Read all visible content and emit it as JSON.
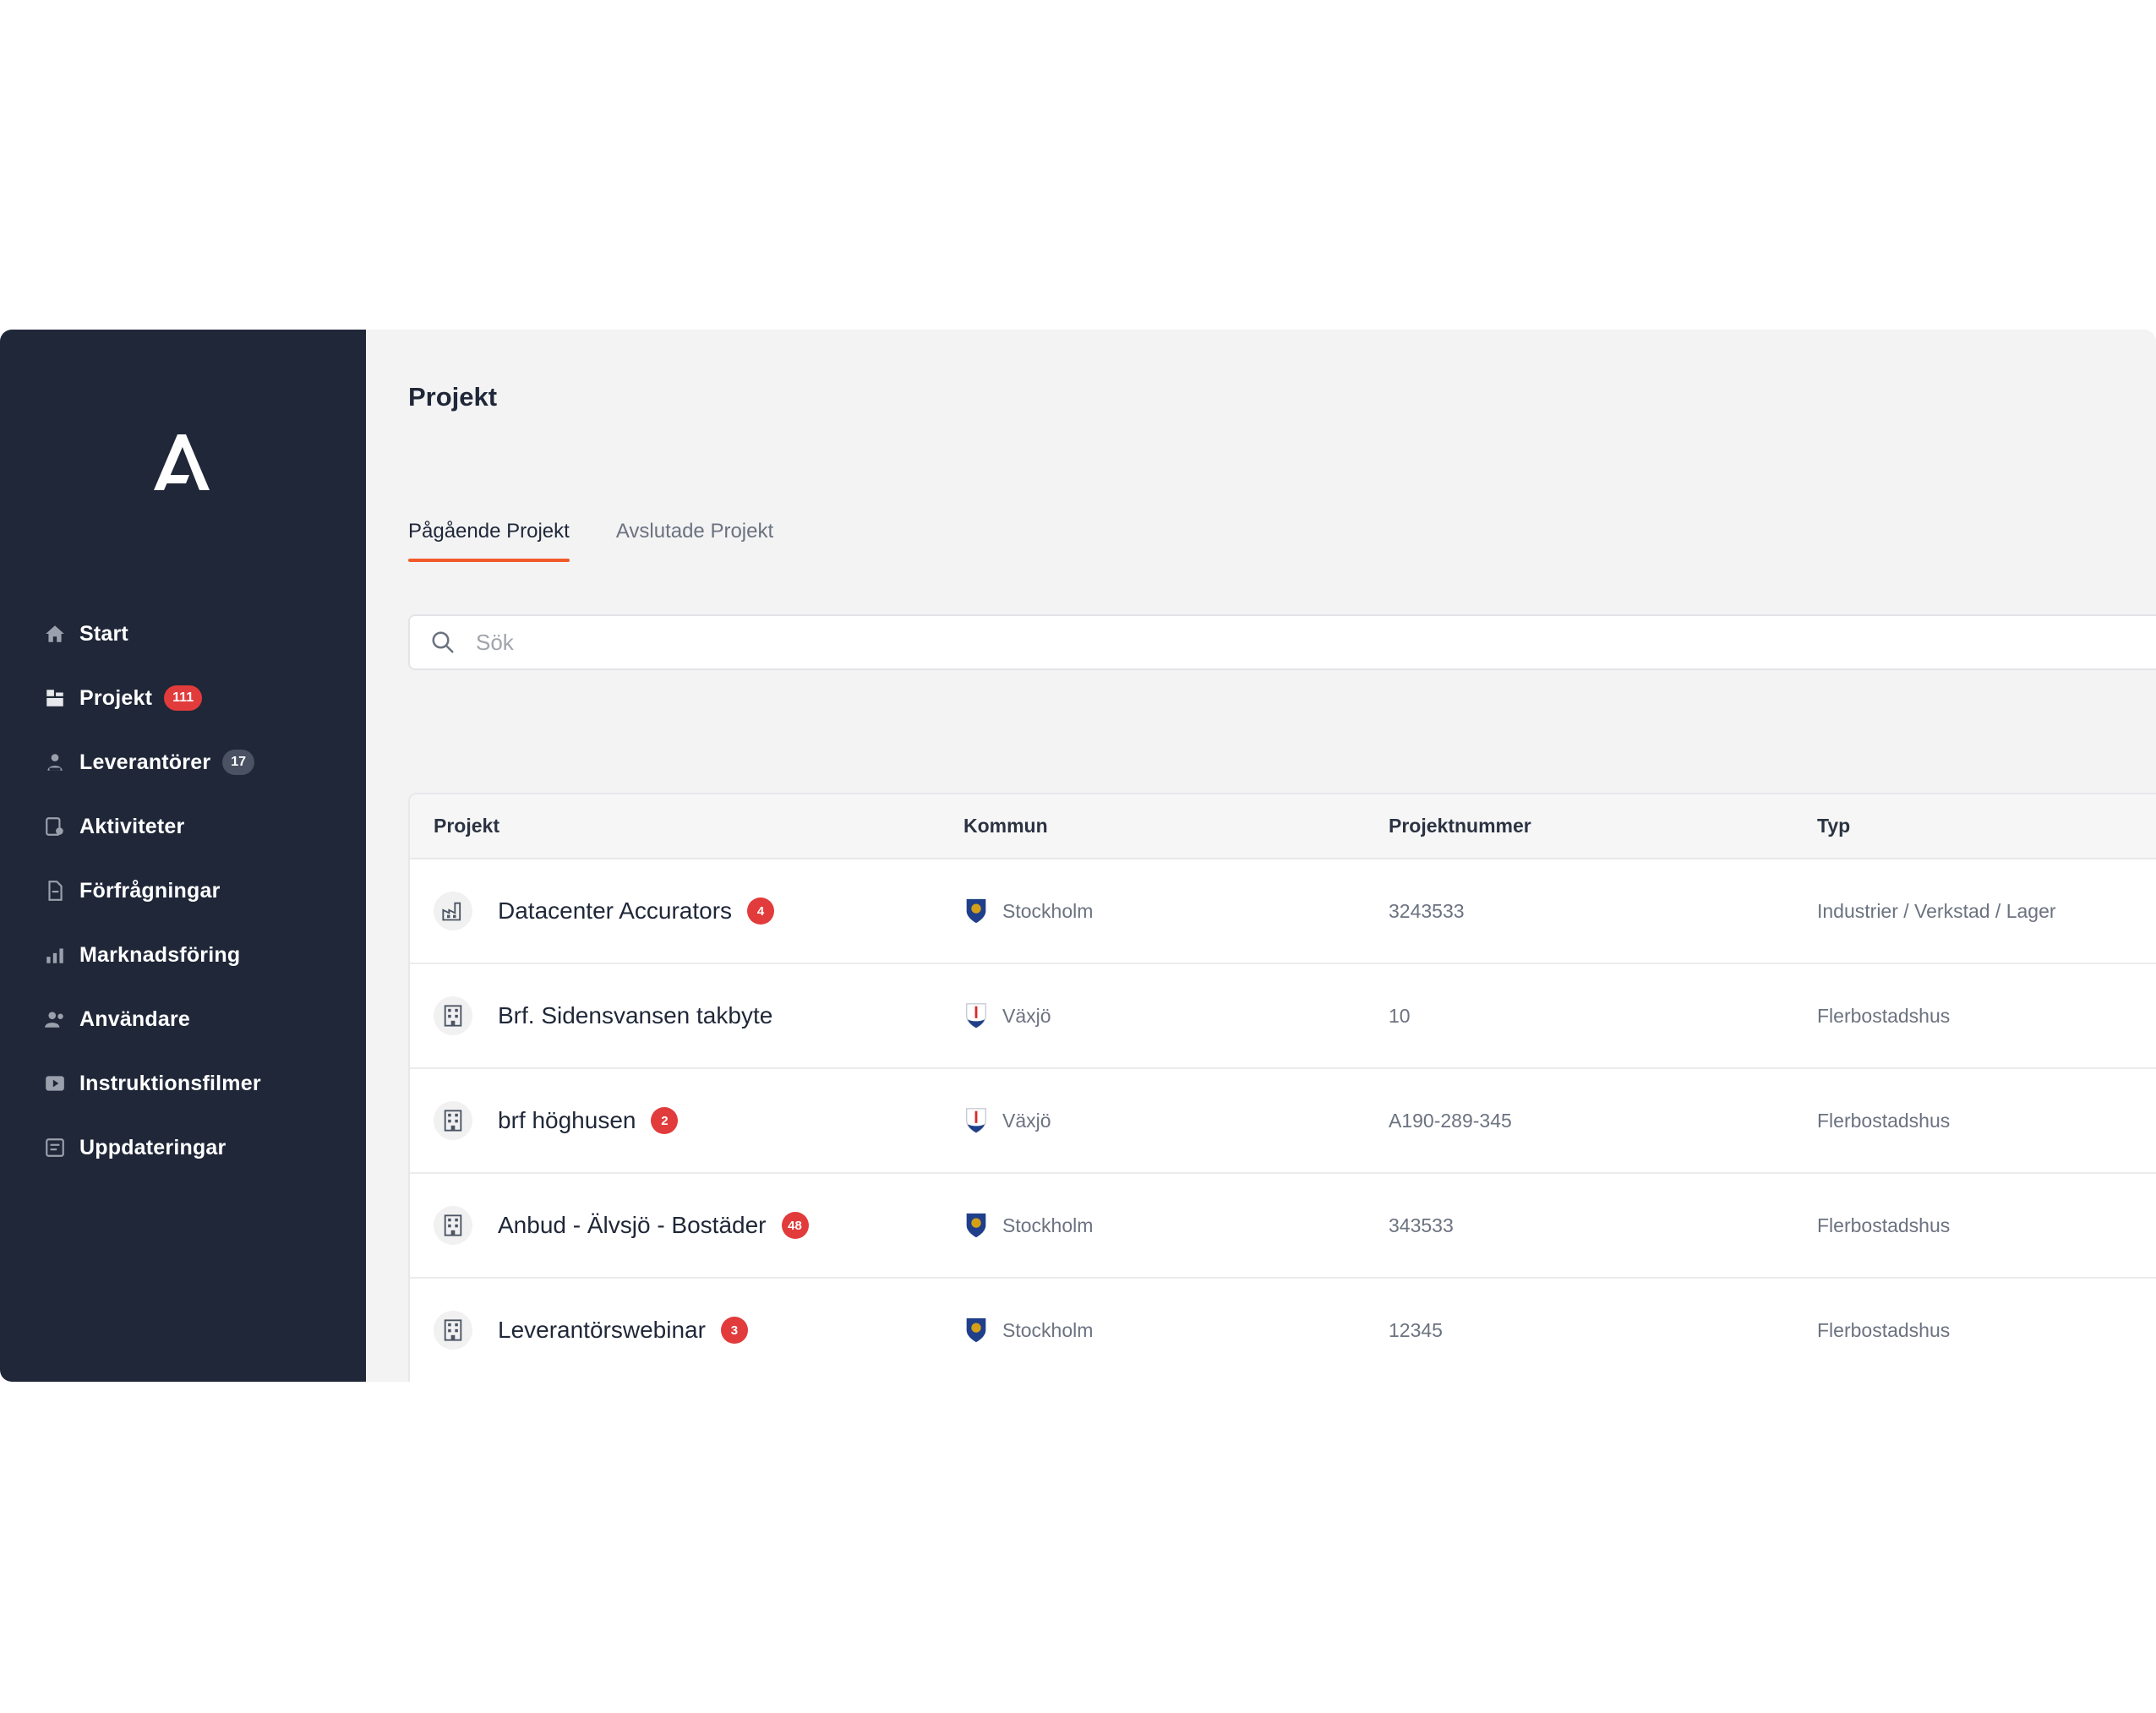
{
  "sidebar": {
    "items": [
      {
        "label": "Start",
        "icon": "home-icon"
      },
      {
        "label": "Projekt",
        "icon": "projects-icon",
        "badge": "111"
      },
      {
        "label": "Leverantörer",
        "icon": "suppliers-icon",
        "badge": "17"
      },
      {
        "label": "Aktiviteter",
        "icon": "activities-icon"
      },
      {
        "label": "Förfrågningar",
        "icon": "inquiries-icon"
      },
      {
        "label": "Marknadsföring",
        "icon": "marketing-icon"
      },
      {
        "label": "Användare",
        "icon": "users-icon"
      },
      {
        "label": "Instruktionsfilmer",
        "icon": "video-icon"
      },
      {
        "label": "Uppdateringar",
        "icon": "updates-icon"
      }
    ]
  },
  "main": {
    "title": "Projekt",
    "tabs": [
      {
        "label": "Pågående Projekt",
        "active": true
      },
      {
        "label": "Avslutade Projekt",
        "active": false
      }
    ],
    "search": {
      "placeholder": "Sök"
    },
    "table": {
      "headers": [
        "Projekt",
        "Kommun",
        "Projektnummer",
        "Typ"
      ],
      "rows": [
        {
          "name": "Datacenter Accurators",
          "badge": "4",
          "kommun": "Stockholm",
          "nummer": "3243533",
          "typ": "Industrier / Verkstad / Lager"
        },
        {
          "name": "Brf. Sidensvansen takbyte",
          "badge": "",
          "kommun": "Växjö",
          "nummer": "10",
          "typ": "Flerbostadshus"
        },
        {
          "name": "brf höghusen",
          "badge": "2",
          "kommun": "Växjö",
          "nummer": "A190-289-345",
          "typ": "Flerbostadshus"
        },
        {
          "name": "Anbud - Älvsjö - Bostäder",
          "badge": "48",
          "kommun": "Stockholm",
          "nummer": "343533",
          "typ": "Flerbostadshus"
        },
        {
          "name": "Leverantörswebinar",
          "badge": "3",
          "kommun": "Stockholm",
          "nummer": "12345",
          "typ": "Flerbostadshus"
        }
      ]
    }
  },
  "colors": {
    "sidebar_bg": "#1f2738",
    "accent": "#f25a2a",
    "badge_red": "#e23b3b",
    "main_bg": "#f3f3f4"
  }
}
